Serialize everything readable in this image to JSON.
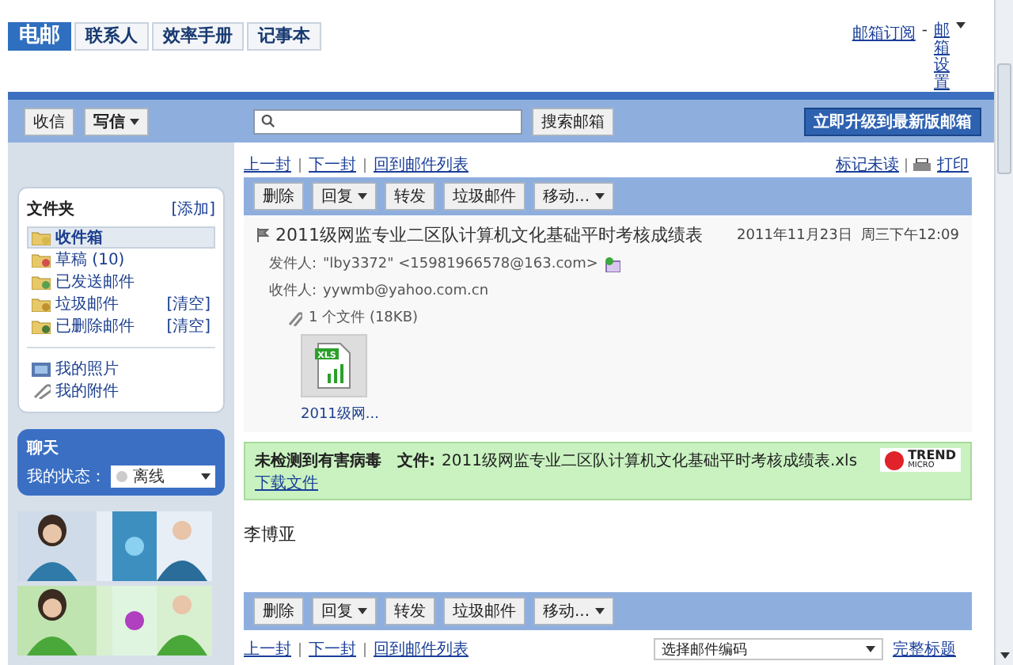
{
  "tabs": [
    {
      "label": "电邮",
      "selected": true
    },
    {
      "label": "联系人",
      "selected": false
    },
    {
      "label": "效率手册",
      "selected": false
    },
    {
      "label": "记事本",
      "selected": false
    }
  ],
  "top_links": [
    "邮箱订阅",
    "-",
    "邮箱设置"
  ],
  "toolbar": {
    "receive": "收信",
    "compose": "写信",
    "search_button": "搜索邮箱",
    "upgrade": "立即升级到最新版邮箱"
  },
  "sidebar": {
    "folders_title": "文件夹",
    "add_link": "[添加]",
    "folders": [
      {
        "label": "收件箱",
        "selected": true
      },
      {
        "label": "草稿 (10)",
        "selected": false
      },
      {
        "label": "已发送邮件",
        "selected": false
      },
      {
        "label": "垃圾邮件",
        "selected": false,
        "action": "[清空]"
      },
      {
        "label": "已删除邮件",
        "selected": false,
        "action": "[清空]"
      }
    ],
    "extras": [
      "我的照片",
      "我的附件"
    ],
    "chat": {
      "title": "聊天",
      "status_label": "我的状态：",
      "status": "离线"
    },
    "ads": [
      {
        "kind": "picture"
      },
      {
        "kind": "picture"
      }
    ]
  },
  "nav_top": [
    "上一封",
    "下一封",
    "回到邮件列表"
  ],
  "right_links": [
    "标记未读",
    "打印"
  ],
  "actions_top": [
    {
      "label": "删除",
      "dropdown": false
    },
    {
      "label": "回复",
      "dropdown": true
    },
    {
      "label": "转发",
      "dropdown": false
    },
    {
      "label": "垃圾邮件",
      "dropdown": false
    },
    {
      "label": "移动...",
      "dropdown": true
    }
  ],
  "message": {
    "subject": "2011级网监专业二区队计算机文化基础平时考核成绩表",
    "date": "2011年11月23日  周三下午12:09",
    "from_label": "发件人:",
    "from": "\"lby3372\" <15981966578@163.com>",
    "to_label": "收件人:",
    "to": "yywmb@yahoo.com.cn",
    "attachment_count": "1 个文件 (18KB)",
    "attachment_name": "2011级网...",
    "file_badge": "XLS",
    "virus_status": "未检测到有害病毒",
    "virus_file_label": "文件:",
    "virus_file": "2011级网监专业二区队计算机文化基础平时考核成绩表.xls",
    "download": "下载文件",
    "scanner_logo": [
      "TREND",
      "MICRO"
    ],
    "body": "李博亚"
  },
  "actions_bottom": [
    {
      "label": "删除",
      "dropdown": false
    },
    {
      "label": "回复",
      "dropdown": true
    },
    {
      "label": "转发",
      "dropdown": false
    },
    {
      "label": "垃圾邮件",
      "dropdown": false
    },
    {
      "label": "移动...",
      "dropdown": true
    }
  ],
  "nav_bottom": [
    "上一封",
    "下一封",
    "回到邮件列表"
  ],
  "bottom": {
    "encoding": "选择邮件编码",
    "full_header": "完整标题"
  }
}
